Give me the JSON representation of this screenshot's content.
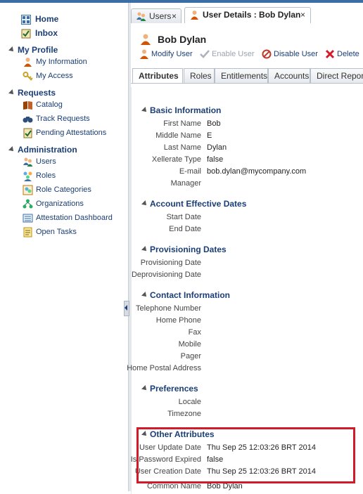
{
  "nav": {
    "home": "Home",
    "inbox": "Inbox",
    "sections": [
      {
        "label": "My Profile",
        "items": [
          "My Information",
          "My Access"
        ]
      },
      {
        "label": "Requests",
        "items": [
          "Catalog",
          "Track Requests",
          "Pending Attestations"
        ]
      },
      {
        "label": "Administration",
        "items": [
          "Users",
          "Roles",
          "Role Categories",
          "Organizations",
          "Attestation Dashboard",
          "Open Tasks"
        ]
      }
    ]
  },
  "tabs": [
    {
      "label": "Users",
      "close": "×"
    },
    {
      "label": "User Details : Bob Dylan",
      "close": "×"
    }
  ],
  "user": {
    "name": "Bob Dylan"
  },
  "toolbar": {
    "modify": "Modify User",
    "enable": "Enable User",
    "disable": "Disable User",
    "delete": "Delete"
  },
  "subtabs": [
    "Attributes",
    "Roles",
    "Entitlements",
    "Accounts",
    "Direct Reports"
  ],
  "sections": {
    "basic": {
      "title": "Basic Information",
      "fields": [
        {
          "label": "First Name",
          "value": "Bob"
        },
        {
          "label": "Middle Name",
          "value": "E"
        },
        {
          "label": "Last Name",
          "value": "Dylan"
        },
        {
          "label": "Xellerate Type",
          "value": "false"
        },
        {
          "label": "E-mail",
          "value": "bob.dylan@mycompany.com"
        },
        {
          "label": "Manager",
          "value": ""
        }
      ]
    },
    "account": {
      "title": "Account Effective Dates",
      "fields": [
        {
          "label": "Start Date",
          "value": ""
        },
        {
          "label": "End Date",
          "value": ""
        }
      ]
    },
    "provisioning": {
      "title": "Provisioning Dates",
      "fields": [
        {
          "label": "Provisioning Date",
          "value": ""
        },
        {
          "label": "Deprovisioning Date",
          "value": ""
        }
      ]
    },
    "contact": {
      "title": "Contact Information",
      "fields": [
        {
          "label": "Telephone Number",
          "value": ""
        },
        {
          "label": "Home Phone",
          "value": ""
        },
        {
          "label": "Fax",
          "value": ""
        },
        {
          "label": "Mobile",
          "value": ""
        },
        {
          "label": "Pager",
          "value": ""
        },
        {
          "label": "Home Postal Address",
          "value": ""
        }
      ]
    },
    "preferences": {
      "title": "Preferences",
      "fields": [
        {
          "label": "Locale",
          "value": ""
        },
        {
          "label": "Timezone",
          "value": ""
        }
      ]
    },
    "other": {
      "title": "Other Attributes",
      "fields": [
        {
          "label": "User Update Date",
          "value": "Thu Sep 25 12:03:26 BRT 2014"
        },
        {
          "label": "Is Password Expired",
          "value": "false"
        },
        {
          "label": "User Creation Date",
          "value": "Thu Sep 25 12:03:26 BRT 2014"
        },
        {
          "label": "Common Name",
          "value": "Bob Dylan"
        }
      ]
    }
  },
  "colors": {
    "accent": "#1b3e75",
    "highlight": "#d11a2a",
    "disabled": "#9aa3ad"
  }
}
